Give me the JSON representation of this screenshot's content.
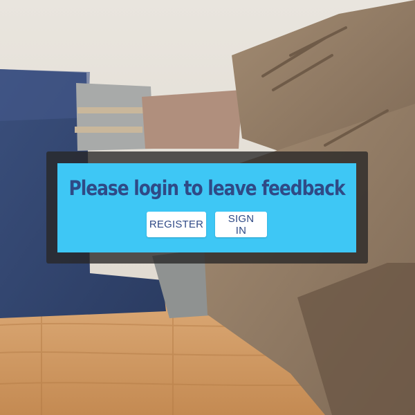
{
  "dialog": {
    "title": "Please login to leave feedback",
    "register_label": "REGISTER",
    "signin_label": "SIGN IN"
  },
  "colors": {
    "panel_background": "#3ec7f5",
    "overlay_background": "#282626",
    "text": "#2f4a86",
    "button_background": "#ffffff"
  },
  "background": {
    "description_icon": "feet-on-table-photo"
  }
}
